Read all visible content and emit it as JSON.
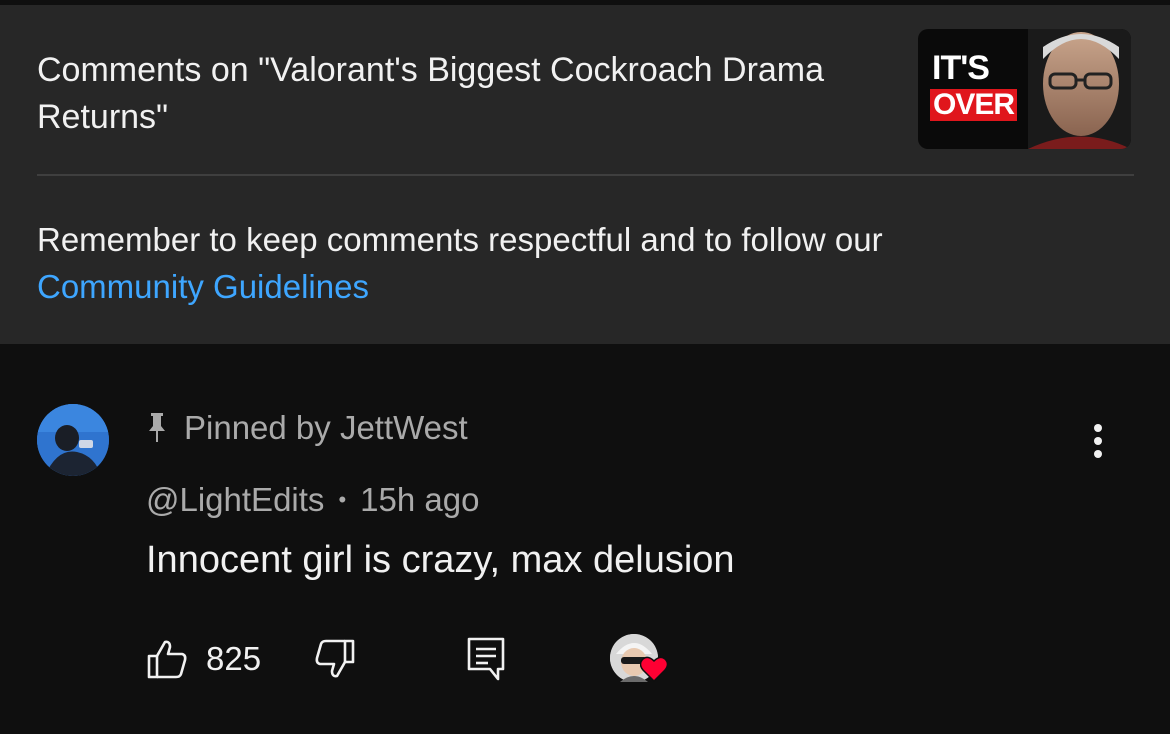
{
  "header": {
    "title": "Comments on \"Valorant's Biggest Cockroach Drama Returns\"",
    "thumbnail": {
      "text_top": "IT'S",
      "text_bottom": "OVER"
    },
    "notice_text": "Remember to keep comments respectful and to follow our",
    "notice_link": "Community Guidelines"
  },
  "comment": {
    "pinned_label": "Pinned by JettWest",
    "author": "@LightEdits",
    "separator": "•",
    "timestamp": "15h ago",
    "text": "Innocent girl is crazy, max delusion",
    "likes": "825"
  },
  "icons": {
    "pin": "pin-icon",
    "more": "more-vert-icon",
    "like": "thumb-up-icon",
    "dislike": "thumb-down-icon",
    "reply": "comment-icon",
    "creator_heart": "heart-icon"
  },
  "colors": {
    "header_bg": "#272727",
    "page_bg": "#0f0f0f",
    "link": "#3ea6ff",
    "heart": "#ff0033"
  }
}
